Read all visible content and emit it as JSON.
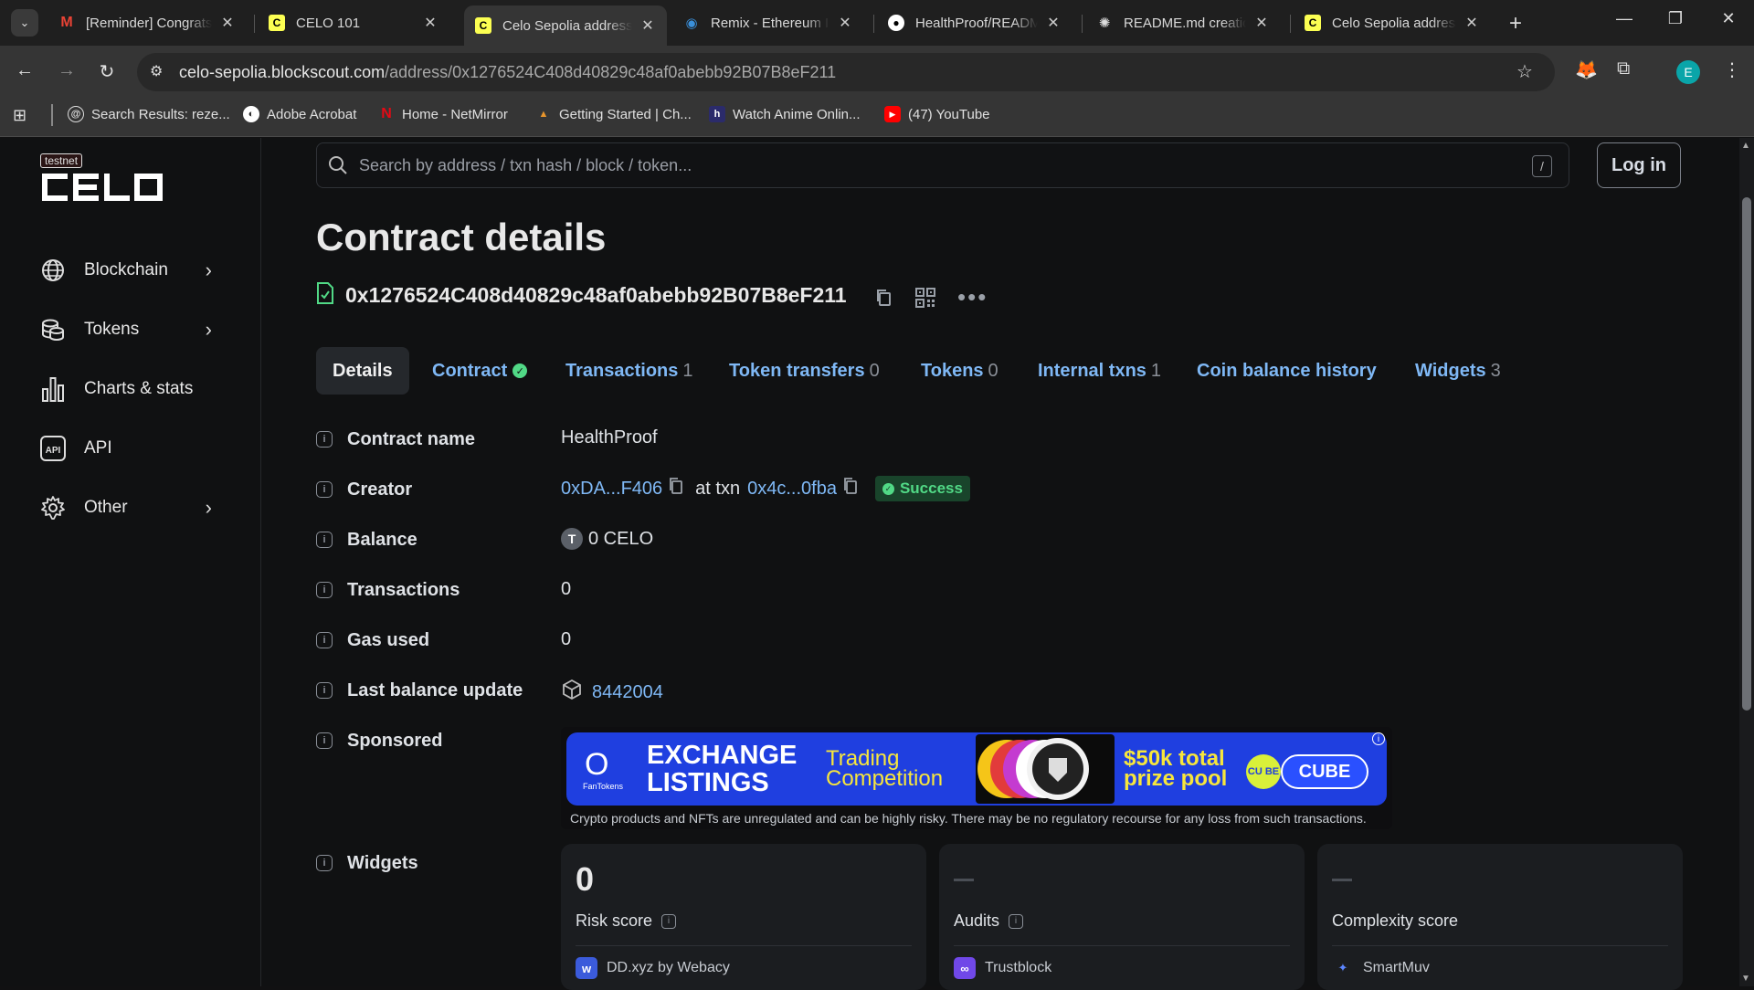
{
  "browser": {
    "tabs": [
      {
        "title": "[Reminder] Congrats",
        "icon": "gmail-icon"
      },
      {
        "title": "CELO 101",
        "icon": "celo-icon"
      },
      {
        "title": "Celo Sepolia address",
        "icon": "celo-icon",
        "active": true
      },
      {
        "title": "Remix - Ethereum IDE",
        "icon": "remix-icon"
      },
      {
        "title": "HealthProof/README",
        "icon": "github-icon"
      },
      {
        "title": "README.md creation",
        "icon": "openai-icon"
      },
      {
        "title": "Celo Sepolia address",
        "icon": "celo-icon"
      }
    ],
    "url_host": "celo-sepolia.blockscout.com",
    "url_path": "/address/0x1276524C408d40829c48af0abebb92B07B8eF211",
    "profile_initial": "E",
    "bookmarks": [
      "Search Results: reze...",
      "Adobe Acrobat",
      "Home - NetMirror",
      "Getting Started | Ch...",
      "Watch Anime Onlin...",
      "(47) YouTube"
    ]
  },
  "sidebar": {
    "badge": "testnet",
    "logo": "CELO",
    "items": [
      {
        "label": "Blockchain",
        "icon": "globe-icon",
        "expandable": true
      },
      {
        "label": "Tokens",
        "icon": "coins-icon",
        "expandable": true
      },
      {
        "label": "Charts & stats",
        "icon": "bar-chart-icon",
        "expandable": false
      },
      {
        "label": "API",
        "icon": "api-icon",
        "expandable": false
      },
      {
        "label": "Other",
        "icon": "gear-icon",
        "expandable": true
      }
    ]
  },
  "header": {
    "search_placeholder": "Search by address / txn hash / block / token...",
    "slash_key": "/",
    "login_label": "Log in"
  },
  "main": {
    "title": "Contract details",
    "address": "0x1276524C408d40829c48af0abebb92B07B8eF211",
    "tabs": [
      {
        "label": "Details",
        "count": ""
      },
      {
        "label": "Contract",
        "count": ""
      },
      {
        "label": "Transactions",
        "count": "1"
      },
      {
        "label": "Token transfers",
        "count": "0"
      },
      {
        "label": "Tokens",
        "count": "0"
      },
      {
        "label": "Internal txns",
        "count": "1"
      },
      {
        "label": "Coin balance history",
        "count": ""
      },
      {
        "label": "Widgets",
        "count": "3"
      }
    ],
    "details": {
      "contract_name_label": "Contract name",
      "contract_name": "HealthProof",
      "creator_label": "Creator",
      "creator_addr": "0xDA...F406",
      "at_txn": "at txn",
      "creator_txn": "0x4c...0fba",
      "status": "Success",
      "balance_label": "Balance",
      "balance_token_letter": "T",
      "balance": "0 CELO",
      "transactions_label": "Transactions",
      "transactions": "0",
      "gas_used_label": "Gas used",
      "gas_used": "0",
      "last_balance_label": "Last balance update",
      "last_balance_block": "8442004",
      "sponsored_label": "Sponsored",
      "widgets_label": "Widgets"
    },
    "banner": {
      "brand": "FanTokens",
      "headline_1": "EXCHANGE",
      "headline_2": "LISTINGS",
      "sub_1": "Trading",
      "sub_2": "Competition",
      "prize_1": "$50k total",
      "prize_2": "prize pool",
      "cube_mark": "CU BE",
      "cube": "CUBE",
      "disclaimer": "Crypto products and NFTs are unregulated and can be highly risky. There may be no regulatory recourse for any loss from such transactions."
    },
    "widgets": [
      {
        "value": "0",
        "label": "Risk score",
        "provider": "DD.xyz by Webacy",
        "provider_color": "#3b5bdb",
        "info": true
      },
      {
        "value": "",
        "label": "Audits",
        "provider": "Trustblock",
        "provider_color": "#7048e8",
        "info": true
      },
      {
        "value": "",
        "label": "Complexity score",
        "provider": "SmartMuv",
        "provider_color": "#1c3d8a",
        "info": false
      }
    ]
  },
  "colors": {
    "link": "#7fb8f5",
    "success": "#51d986",
    "bg": "#101112"
  }
}
